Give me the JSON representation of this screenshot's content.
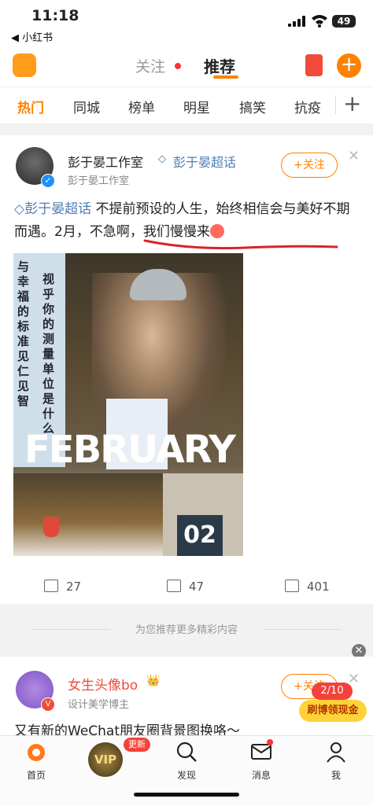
{
  "status_bar": {
    "time": "11:18",
    "back_app": "◀ 小红书",
    "battery": "49"
  },
  "header": {
    "tab_follow": "关注",
    "tab_recommend": "推荐",
    "plus": "+"
  },
  "channels": [
    "热门",
    "同城",
    "榜单",
    "明星",
    "搞笑",
    "抗疫"
  ],
  "channel_more": "+",
  "post1": {
    "author": "彭于晏工作室",
    "topic": "彭于晏超话",
    "meta": "彭于晏工作室",
    "follow_label": "+关注",
    "close": "✕",
    "text_topic": "彭于晏超话",
    "text_body": " 不提前预设的人生，始终相信会与美好不期而遇。2月，不急啊，我们慢慢来",
    "image": {
      "side_text_a": "与幸福的标准见仁见智",
      "side_text_b": "视乎你的测量单位是什么",
      "big_word": "FEBRUARY",
      "number": "02"
    },
    "repost_count": "27",
    "comment_count": "47",
    "like_count": "401"
  },
  "recommend_hint": "为您推荐更多精彩内容",
  "post2": {
    "author": "女生头像bo",
    "badge": "👑",
    "meta": "设计美学博主",
    "follow_label": "+关注",
    "close": "✕",
    "text": "又有新的WeChat朋友圈背景图换咯～"
  },
  "cash": {
    "count": "2/10",
    "label": "刷博领现金"
  },
  "tabbar": {
    "home": "首页",
    "vip": "VIP",
    "vip_badge": "更新",
    "discover": "发现",
    "messages": "消息",
    "me": "我"
  },
  "colors": {
    "accent": "#ff8200",
    "link": "#507daf",
    "alert": "#f3423a"
  }
}
